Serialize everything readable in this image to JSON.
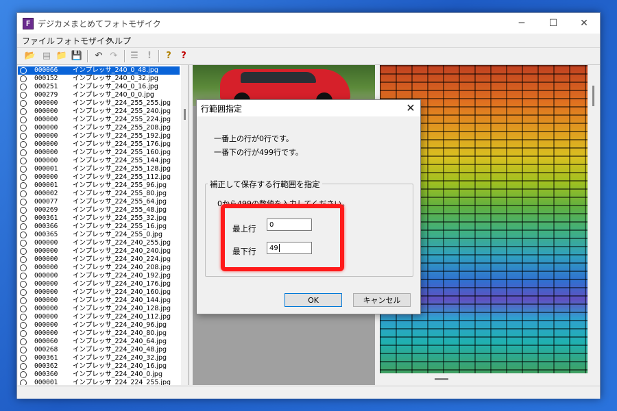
{
  "window": {
    "title": "デジカメまとめてフォトモザイク",
    "icon_letter": "F",
    "controls": [
      "─",
      "☐",
      "✕"
    ]
  },
  "menu": [
    "ファイル",
    "フォトモザイク",
    "ヘルプ"
  ],
  "toolbar": {
    "buttons": [
      "open-folder",
      "open-image",
      "folder",
      "save",
      "undo",
      "redo",
      "list",
      "exclamation",
      "help",
      "context-help"
    ],
    "glyphs": [
      "📂",
      "▤",
      "📁",
      "💾",
      "↶",
      "↷",
      "☰",
      "!",
      "?",
      "?"
    ]
  },
  "file_list": [
    {
      "num": "000066",
      "name": "インプレッサ_240_0_48.jpg",
      "selected": true
    },
    {
      "num": "000152",
      "name": "インプレッサ_240_0_32.jpg"
    },
    {
      "num": "000251",
      "name": "インプレッサ_240_0_16.jpg"
    },
    {
      "num": "000279",
      "name": "インプレッサ_240_0_0.jpg"
    },
    {
      "num": "000000",
      "name": "インプレッサ_224_255_255.jpg"
    },
    {
      "num": "000000",
      "name": "インプレッサ_224_255_240.jpg"
    },
    {
      "num": "000000",
      "name": "インプレッサ_224_255_224.jpg"
    },
    {
      "num": "000000",
      "name": "インプレッサ_224_255_208.jpg"
    },
    {
      "num": "000000",
      "name": "インプレッサ_224_255_192.jpg"
    },
    {
      "num": "000000",
      "name": "インプレッサ_224_255_176.jpg"
    },
    {
      "num": "000000",
      "name": "インプレッサ_224_255_160.jpg"
    },
    {
      "num": "000000",
      "name": "インプレッサ_224_255_144.jpg"
    },
    {
      "num": "000001",
      "name": "インプレッサ_224_255_128.jpg"
    },
    {
      "num": "000000",
      "name": "インプレッサ_224_255_112.jpg"
    },
    {
      "num": "000001",
      "name": "インプレッサ_224_255_96.jpg"
    },
    {
      "num": "000002",
      "name": "インプレッサ_224_255_80.jpg"
    },
    {
      "num": "000077",
      "name": "インプレッサ_224_255_64.jpg"
    },
    {
      "num": "000269",
      "name": "インプレッサ_224_255_48.jpg"
    },
    {
      "num": "000361",
      "name": "インプレッサ_224_255_32.jpg"
    },
    {
      "num": "000366",
      "name": "インプレッサ_224_255_16.jpg"
    },
    {
      "num": "000365",
      "name": "インプレッサ_224_255_0.jpg"
    },
    {
      "num": "000000",
      "name": "インプレッサ_224_240_255.jpg"
    },
    {
      "num": "000000",
      "name": "インプレッサ_224_240_240.jpg"
    },
    {
      "num": "000000",
      "name": "インプレッサ_224_240_224.jpg"
    },
    {
      "num": "000000",
      "name": "インプレッサ_224_240_208.jpg"
    },
    {
      "num": "000000",
      "name": "インプレッサ_224_240_192.jpg"
    },
    {
      "num": "000000",
      "name": "インプレッサ_224_240_176.jpg"
    },
    {
      "num": "000000",
      "name": "インプレッサ_224_240_160.jpg"
    },
    {
      "num": "000000",
      "name": "インプレッサ_224_240_144.jpg"
    },
    {
      "num": "000000",
      "name": "インプレッサ_224_240_128.jpg"
    },
    {
      "num": "000000",
      "name": "インプレッサ_224_240_112.jpg"
    },
    {
      "num": "000000",
      "name": "インプレッサ_224_240_96.jpg"
    },
    {
      "num": "000000",
      "name": "インプレッサ_224_240_80.jpg"
    },
    {
      "num": "000060",
      "name": "インプレッサ_224_240_64.jpg"
    },
    {
      "num": "000268",
      "name": "インプレッサ_224_240_48.jpg"
    },
    {
      "num": "000361",
      "name": "インプレッサ_224_240_32.jpg"
    },
    {
      "num": "000362",
      "name": "インプレッサ_224_240_16.jpg"
    },
    {
      "num": "000360",
      "name": "インプレッサ_224_240_0.jpg"
    },
    {
      "num": "000001",
      "name": "インプレッサ_224_224_255.jpg"
    }
  ],
  "dialog": {
    "title": "行範囲指定",
    "close": "✕",
    "line1": "一番上の行が0行です。",
    "line2": "一番下の行が499行です。",
    "group_label": "補正して保存する行範囲を指定",
    "instruction": "0から499の数値を入力してください。",
    "top_label": "最上行",
    "top_value": "0",
    "bottom_label": "最下行",
    "bottom_value": "49",
    "ok": "OK",
    "cancel": "キャンセル"
  },
  "colors": {
    "selection": "#0a64d8",
    "highlight": "#ff1a1a"
  }
}
